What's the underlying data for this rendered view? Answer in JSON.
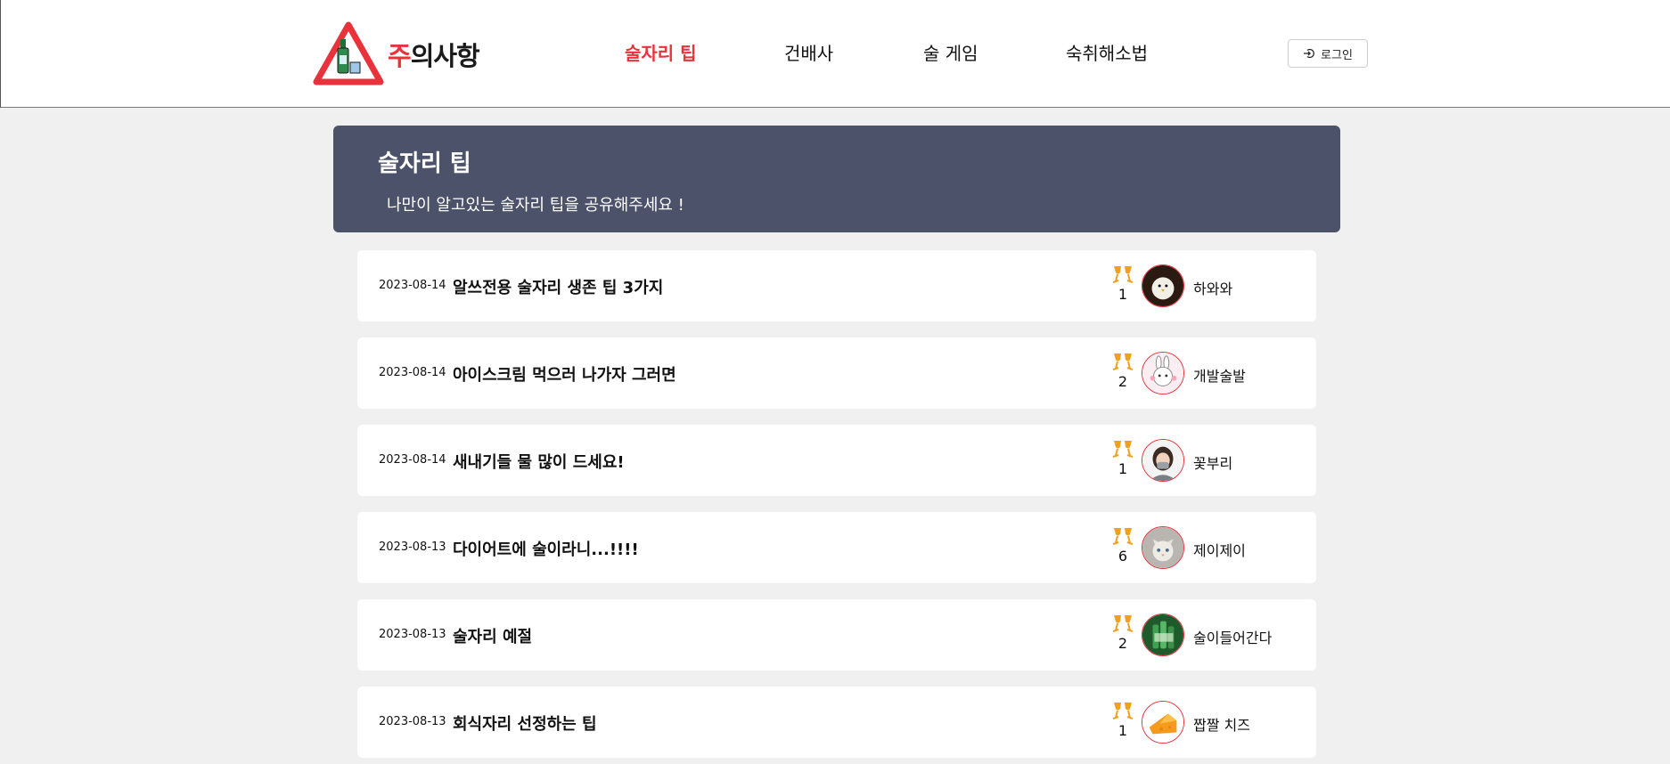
{
  "header": {
    "logo": {
      "accent": "주",
      "rest": "의사항"
    },
    "nav": [
      {
        "label": "술자리 팁",
        "active": true
      },
      {
        "label": "건배사",
        "active": false
      },
      {
        "label": "술 게임",
        "active": false
      },
      {
        "label": "숙취해소법",
        "active": false
      }
    ],
    "login_label": "로그인"
  },
  "banner": {
    "title": "술자리 팁",
    "subtitle": "나만이 알고있는 술자리 팁을 공유해주세요 !"
  },
  "posts": [
    {
      "date": "2023-08-14",
      "title": "알쓰전용 술자리 생존 팁 3가지",
      "cheers": "1",
      "author": "하와와",
      "avatar_icon": "chick-avatar-icon"
    },
    {
      "date": "2023-08-14",
      "title": "아이스크림 먹으러 나가자 그러면",
      "cheers": "2",
      "author": "개발술발",
      "avatar_icon": "rabbit-avatar-icon"
    },
    {
      "date": "2023-08-14",
      "title": "새내기들 물 많이 드세요!",
      "cheers": "1",
      "author": "꽃부리",
      "avatar_icon": "person-avatar-icon"
    },
    {
      "date": "2023-08-13",
      "title": "다이어트에 술이라니...!!!!",
      "cheers": "6",
      "author": "제이제이",
      "avatar_icon": "cat-avatar-icon"
    },
    {
      "date": "2023-08-13",
      "title": "술자리 예절",
      "cheers": "2",
      "author": "술이들어간다",
      "avatar_icon": "bottles-avatar-icon"
    },
    {
      "date": "2023-08-13",
      "title": "회식자리 선정하는 팁",
      "cheers": "1",
      "author": "짭짤 치즈",
      "avatar_icon": "cheese-avatar-icon"
    }
  ],
  "colors": {
    "accent": "#e8333c",
    "banner": "#4b526a",
    "background": "#f0f0f0",
    "cheers_icon": "#f0a020"
  }
}
